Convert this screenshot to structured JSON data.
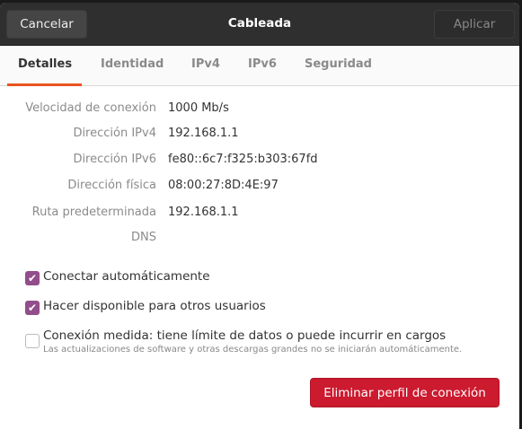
{
  "header": {
    "title": "Cableada",
    "cancel": "Cancelar",
    "apply": "Aplicar"
  },
  "tabs": [
    "Detalles",
    "Identidad",
    "IPv4",
    "IPv6",
    "Seguridad"
  ],
  "details": [
    {
      "label": "Velocidad de conexión",
      "value": "1000 Mb/s"
    },
    {
      "label": "Dirección IPv4",
      "value": "192.168.1.1"
    },
    {
      "label": "Dirección IPv6",
      "value": "fe80::6c7:f325:b303:67fd"
    },
    {
      "label": "Dirección física",
      "value": "08:00:27:8D:4E:97"
    },
    {
      "label": "Ruta predeterminada",
      "value": "192.168.1.1"
    },
    {
      "label": "DNS",
      "value": ""
    }
  ],
  "options": [
    {
      "label": "Conectar automáticamente",
      "checked": true
    },
    {
      "label": "Hacer disponible para otros usuarios",
      "checked": true
    },
    {
      "label": "Conexión medida: tiene límite de datos o puede incurrir en cargos",
      "checked": false,
      "subtitle": "Las actualizaciones de software y otras descargas grandes no se iniciarán automáticamente."
    }
  ],
  "delete_button": "Eliminar perfil de conexión",
  "colors": {
    "accent": "#e95420",
    "check": "#924d8b",
    "destructive": "#cc1a2f"
  }
}
